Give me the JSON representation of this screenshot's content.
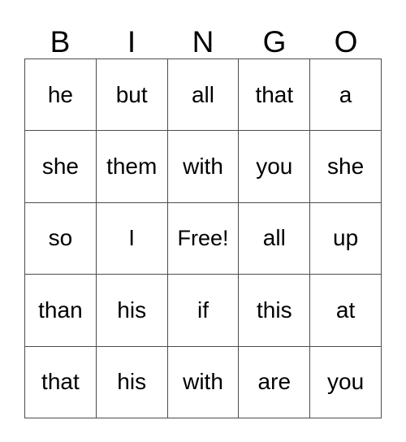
{
  "card": {
    "header_letters": [
      "B",
      "I",
      "N",
      "G",
      "O"
    ],
    "free_space_label": "Free!",
    "free_space_position": {
      "row": 2,
      "col": 2
    },
    "grid_size": "5x5",
    "colors": {
      "background": "#ffffff",
      "text": "#000000",
      "border": "#4d4d4d"
    },
    "rows": [
      {
        "cells": [
          "he",
          "but",
          "all",
          "that",
          "a"
        ]
      },
      {
        "cells": [
          "she",
          "them",
          "with",
          "you",
          "she"
        ]
      },
      {
        "cells": [
          "so",
          "I",
          "Free!",
          "all",
          "up"
        ]
      },
      {
        "cells": [
          "than",
          "his",
          "if",
          "this",
          "at"
        ]
      },
      {
        "cells": [
          "that",
          "his",
          "with",
          "are",
          "you"
        ]
      }
    ]
  }
}
